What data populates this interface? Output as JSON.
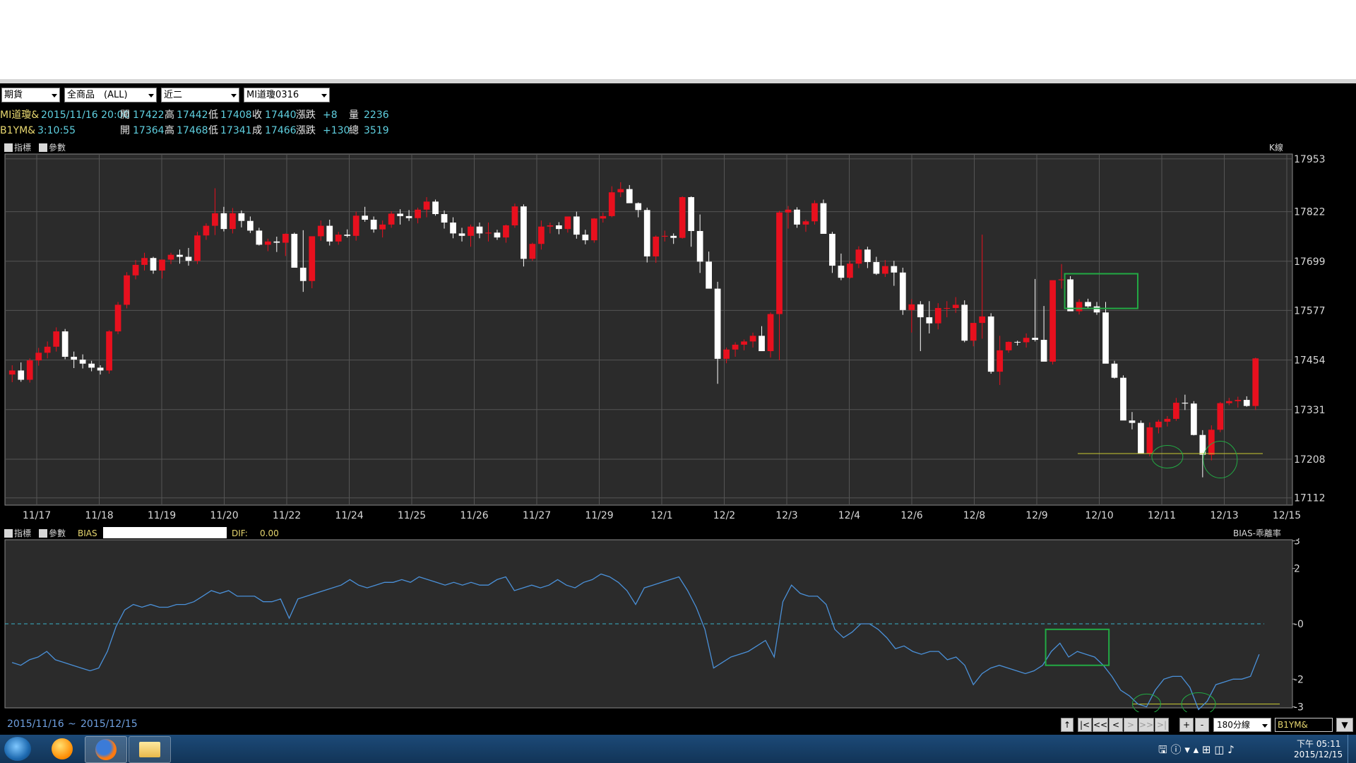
{
  "toolbar": {
    "market": "期貨",
    "product": "全商品　(ALL)",
    "month": "近二",
    "contract": "MI道瓊0316"
  },
  "quote1": {
    "name": "MI道瓊&",
    "datetime": "2015/11/16 20:00",
    "open_label": "開",
    "open": "17422",
    "high_label": "高",
    "high": "17442",
    "low_label": "低",
    "low": "17408",
    "close_label": "收",
    "close": "17440",
    "chg_label": "漲跌",
    "chg": "+8",
    "vol_label": "量",
    "vol": "2236"
  },
  "quote2": {
    "name": "B1YM&",
    "time": "3:10:55",
    "open_label": "開",
    "open": "17364",
    "high_label": "高",
    "high": "17468",
    "low_label": "低",
    "low": "17341",
    "close_label": "成",
    "close": "17466",
    "chg_label": "漲跌",
    "chg": "+130",
    "vol_label": "總",
    "vol": "3519"
  },
  "main_panel": {
    "indicator_label": "指標",
    "param_label": "參數",
    "right_label": "K線"
  },
  "sub_panel": {
    "indicator_label": "指標",
    "param_label": "參數",
    "indicator_name": "BIAS",
    "dif_label": "DIF:",
    "dif_value": "0.00",
    "right_label": "BIAS-乖離率"
  },
  "chart_data": [
    {
      "type": "candlestick",
      "y_ticks": [
        17953,
        17822,
        17699,
        17577,
        17454,
        17331,
        17208,
        17112
      ],
      "ylim": [
        17094,
        17965
      ],
      "x_ticks": [
        "11/17",
        "11/18",
        "11/19",
        "11/20",
        "11/22",
        "11/24",
        "11/25",
        "11/26",
        "11/27",
        "11/29",
        "12/1",
        "12/2",
        "12/3",
        "12/4",
        "12/6",
        "12/8",
        "12/9",
        "12/10",
        "12/11",
        "12/13",
        "12/15"
      ],
      "up_color": "#e8101e",
      "down_color": "#ffffff",
      "support_line": 17222,
      "support_color": "#c8c832",
      "highlight_color": "#22aa44",
      "candles": [
        [
          17418,
          17441,
          17399,
          17428
        ],
        [
          17428,
          17448,
          17400,
          17405
        ],
        [
          17405,
          17458,
          17398,
          17453
        ],
        [
          17453,
          17484,
          17440,
          17472
        ],
        [
          17472,
          17500,
          17458,
          17487
        ],
        [
          17487,
          17535,
          17475,
          17525
        ],
        [
          17525,
          17531,
          17456,
          17462
        ],
        [
          17462,
          17475,
          17434,
          17455
        ],
        [
          17455,
          17468,
          17433,
          17445
        ],
        [
          17445,
          17452,
          17426,
          17435
        ],
        [
          17435,
          17441,
          17418,
          17428
        ],
        [
          17428,
          17528,
          17420,
          17525
        ],
        [
          17525,
          17598,
          17518,
          17591
        ],
        [
          17591,
          17672,
          17582,
          17664
        ],
        [
          17664,
          17702,
          17654,
          17690
        ],
        [
          17690,
          17720,
          17676,
          17707
        ],
        [
          17707,
          17710,
          17668,
          17676
        ],
        [
          17676,
          17702,
          17656,
          17703
        ],
        [
          17703,
          17720,
          17692,
          17715
        ],
        [
          17715,
          17728,
          17693,
          17710
        ],
        [
          17710,
          17732,
          17688,
          17700
        ],
        [
          17700,
          17772,
          17692,
          17763
        ],
        [
          17763,
          17793,
          17752,
          17787
        ],
        [
          17787,
          17880,
          17764,
          17818
        ],
        [
          17818,
          17834,
          17773,
          17779
        ],
        [
          17779,
          17831,
          17768,
          17818
        ],
        [
          17818,
          17825,
          17783,
          17799
        ],
        [
          17799,
          17810,
          17769,
          17775
        ],
        [
          17775,
          17782,
          17738,
          17740
        ],
        [
          17740,
          17755,
          17724,
          17748
        ],
        [
          17748,
          17760,
          17722,
          17745
        ],
        [
          17745,
          17768,
          17712,
          17767
        ],
        [
          17767,
          17770,
          17705,
          17683
        ],
        [
          17683,
          17776,
          17623,
          17650
        ],
        [
          17650,
          17710,
          17632,
          17761
        ],
        [
          17761,
          17800,
          17750,
          17787
        ],
        [
          17787,
          17802,
          17738,
          17748
        ],
        [
          17748,
          17772,
          17740,
          17765
        ],
        [
          17765,
          17778,
          17758,
          17762
        ],
        [
          17762,
          17822,
          17750,
          17812
        ],
        [
          17812,
          17834,
          17797,
          17802
        ],
        [
          17802,
          17810,
          17770,
          17778
        ],
        [
          17778,
          17800,
          17758,
          17790
        ],
        [
          17790,
          17823,
          17782,
          17817
        ],
        [
          17817,
          17828,
          17790,
          17811
        ],
        [
          17811,
          17826,
          17799,
          17806
        ],
        [
          17806,
          17832,
          17793,
          17827
        ],
        [
          17827,
          17858,
          17808,
          17847
        ],
        [
          17847,
          17852,
          17812,
          17816
        ],
        [
          17816,
          17825,
          17780,
          17795
        ],
        [
          17795,
          17808,
          17756,
          17768
        ],
        [
          17768,
          17782,
          17748,
          17762
        ],
        [
          17762,
          17790,
          17735,
          17785
        ],
        [
          17785,
          17795,
          17756,
          17768
        ],
        [
          17768,
          17795,
          17748,
          17770
        ],
        [
          17770,
          17777,
          17752,
          17758
        ],
        [
          17758,
          17790,
          17745,
          17788
        ],
        [
          17788,
          17842,
          17782,
          17835
        ],
        [
          17835,
          17840,
          17686,
          17705
        ],
        [
          17705,
          17745,
          17700,
          17742
        ],
        [
          17742,
          17800,
          17728,
          17785
        ],
        [
          17785,
          17795,
          17768,
          17788
        ],
        [
          17788,
          17796,
          17766,
          17779
        ],
        [
          17779,
          17810,
          17770,
          17810
        ],
        [
          17810,
          17822,
          17755,
          17765
        ],
        [
          17765,
          17777,
          17741,
          17751
        ],
        [
          17751,
          17806,
          17745,
          17805
        ],
        [
          17805,
          17820,
          17795,
          17811
        ],
        [
          17811,
          17885,
          17808,
          17870
        ],
        [
          17870,
          17895,
          17858,
          17878
        ],
        [
          17878,
          17888,
          17844,
          17843
        ],
        [
          17843,
          17845,
          17808,
          17826
        ],
        [
          17826,
          17832,
          17696,
          17711
        ],
        [
          17711,
          17763,
          17695,
          17760
        ],
        [
          17760,
          17775,
          17748,
          17762
        ],
        [
          17762,
          17768,
          17742,
          17757
        ],
        [
          17757,
          17860,
          17755,
          17858
        ],
        [
          17858,
          17860,
          17735,
          17774
        ],
        [
          17774,
          17815,
          17670,
          17698
        ],
        [
          17698,
          17723,
          17635,
          17631
        ],
        [
          17631,
          17648,
          17395,
          17457
        ],
        [
          17457,
          17485,
          17446,
          17480
        ],
        [
          17480,
          17498,
          17462,
          17492
        ],
        [
          17492,
          17505,
          17478,
          17500
        ],
        [
          17500,
          17522,
          17485,
          17514
        ],
        [
          17514,
          17538,
          17480,
          17476
        ],
        [
          17476,
          17572,
          17460,
          17568
        ],
        [
          17568,
          17824,
          17454,
          17820
        ],
        [
          17820,
          17836,
          17780,
          17827
        ],
        [
          17827,
          17833,
          17782,
          17790
        ],
        [
          17790,
          17802,
          17772,
          17798
        ],
        [
          17798,
          17850,
          17790,
          17843
        ],
        [
          17843,
          17852,
          17778,
          17767
        ],
        [
          17767,
          17772,
          17670,
          17688
        ],
        [
          17688,
          17718,
          17652,
          17658
        ],
        [
          17658,
          17700,
          17656,
          17693
        ],
        [
          17693,
          17736,
          17682,
          17728
        ],
        [
          17728,
          17735,
          17682,
          17697
        ],
        [
          17697,
          17710,
          17665,
          17668
        ],
        [
          17668,
          17702,
          17660,
          17687
        ],
        [
          17687,
          17700,
          17638,
          17671
        ],
        [
          17671,
          17683,
          17566,
          17578
        ],
        [
          17578,
          17605,
          17522,
          17592
        ],
        [
          17592,
          17600,
          17476,
          17560
        ],
        [
          17560,
          17600,
          17520,
          17545
        ],
        [
          17545,
          17595,
          17530,
          17583
        ],
        [
          17583,
          17600,
          17560,
          17583
        ],
        [
          17583,
          17610,
          17571,
          17591
        ],
        [
          17591,
          17602,
          17498,
          17502
        ],
        [
          17502,
          17540,
          17488,
          17546
        ],
        [
          17546,
          17765,
          17507,
          17562
        ],
        [
          17562,
          17570,
          17420,
          17425
        ],
        [
          17425,
          17514,
          17392,
          17478
        ],
        [
          17478,
          17500,
          17472,
          17499
        ],
        [
          17499,
          17502,
          17490,
          17498
        ],
        [
          17498,
          17520,
          17485,
          17509
        ],
        [
          17509,
          17655,
          17500,
          17504
        ],
        [
          17504,
          17588,
          17466,
          17450
        ],
        [
          17450,
          17648,
          17443,
          17652
        ],
        [
          17652,
          17692,
          17631,
          17654
        ],
        [
          17654,
          17662,
          17577,
          17575
        ],
        [
          17575,
          17605,
          17567,
          17598
        ],
        [
          17598,
          17606,
          17583,
          17587
        ],
        [
          17587,
          17598,
          17566,
          17572
        ],
        [
          17572,
          17598,
          17544,
          17445
        ],
        [
          17445,
          17452,
          17408,
          17410
        ],
        [
          17410,
          17416,
          17368,
          17304
        ],
        [
          17304,
          17325,
          17282,
          17298
        ],
        [
          17298,
          17304,
          17226,
          17221
        ],
        [
          17221,
          17299,
          17215,
          17287
        ],
        [
          17287,
          17306,
          17272,
          17301
        ],
        [
          17301,
          17315,
          17289,
          17308
        ],
        [
          17308,
          17360,
          17303,
          17348
        ],
        [
          17348,
          17368,
          17330,
          17346
        ],
        [
          17346,
          17352,
          17267,
          17268
        ],
        [
          17268,
          17280,
          17163,
          17219
        ],
        [
          17219,
          17292,
          17205,
          17281
        ],
        [
          17281,
          17350,
          17275,
          17347
        ],
        [
          17347,
          17360,
          17342,
          17352
        ],
        [
          17352,
          17363,
          17336,
          17355
        ],
        [
          17355,
          17364,
          17338,
          17340
        ],
        [
          17340,
          17460,
          17330,
          17458
        ]
      ]
    },
    {
      "type": "line",
      "name": "BIAS-乖離率",
      "y_ticks": [
        3,
        2,
        0,
        -2,
        -3
      ],
      "ylim": [
        -3.04,
        3.04
      ],
      "zero_line": 0,
      "support_line": -2.9,
      "line_color": "#4a90d8",
      "values": [
        -1.4,
        -1.5,
        -1.3,
        -1.2,
        -1.0,
        -1.3,
        -1.4,
        -1.5,
        -1.6,
        -1.7,
        -1.6,
        -1.0,
        -0.1,
        0.5,
        0.7,
        0.6,
        0.7,
        0.6,
        0.6,
        0.7,
        0.7,
        0.8,
        1.0,
        1.2,
        1.1,
        1.2,
        1.0,
        1.0,
        1.0,
        0.8,
        0.8,
        0.9,
        0.2,
        0.9,
        1.0,
        1.1,
        1.2,
        1.3,
        1.4,
        1.6,
        1.4,
        1.3,
        1.4,
        1.5,
        1.5,
        1.6,
        1.5,
        1.7,
        1.6,
        1.5,
        1.4,
        1.5,
        1.4,
        1.5,
        1.4,
        1.4,
        1.6,
        1.7,
        1.2,
        1.3,
        1.4,
        1.3,
        1.4,
        1.6,
        1.4,
        1.3,
        1.5,
        1.6,
        1.8,
        1.7,
        1.5,
        1.2,
        0.7,
        1.3,
        1.4,
        1.5,
        1.6,
        1.7,
        1.2,
        0.6,
        -0.2,
        -1.6,
        -1.4,
        -1.2,
        -1.1,
        -1.0,
        -0.8,
        -0.6,
        -1.2,
        0.8,
        1.4,
        1.1,
        1.0,
        1.0,
        0.7,
        -0.2,
        -0.5,
        -0.3,
        0.0,
        0.0,
        -0.2,
        -0.5,
        -0.9,
        -0.8,
        -1.0,
        -1.1,
        -1.0,
        -1.0,
        -1.3,
        -1.2,
        -1.5,
        -2.2,
        -1.8,
        -1.6,
        -1.5,
        -1.6,
        -1.7,
        -1.8,
        -1.7,
        -1.5,
        -1.0,
        -0.7,
        -1.2,
        -1.0,
        -1.1,
        -1.2,
        -1.5,
        -1.9,
        -2.4,
        -2.6,
        -2.9,
        -3.0,
        -2.4,
        -2.0,
        -1.9,
        -1.9,
        -2.3,
        -3.1,
        -2.8,
        -2.2,
        -2.1,
        -2.0,
        -2.0,
        -1.9,
        -1.1
      ]
    }
  ],
  "date_range": {
    "from": "2015/11/16",
    "sep": "~",
    "to": "2015/12/15"
  },
  "controls": {
    "period": "180分線",
    "symbol": "B1YM&",
    "btn_first": "|<",
    "btn_prev2": "<<",
    "btn_prev": "<",
    "btn_next": ">",
    "btn_next2": ">>",
    "btn_last": ">|",
    "btn_zoom_in": "+",
    "btn_zoom_out": "-",
    "btn_up": "↑",
    "btn_down": "▼"
  },
  "taskbar": {
    "time": "下午 05:11",
    "date": "2015/12/15"
  }
}
